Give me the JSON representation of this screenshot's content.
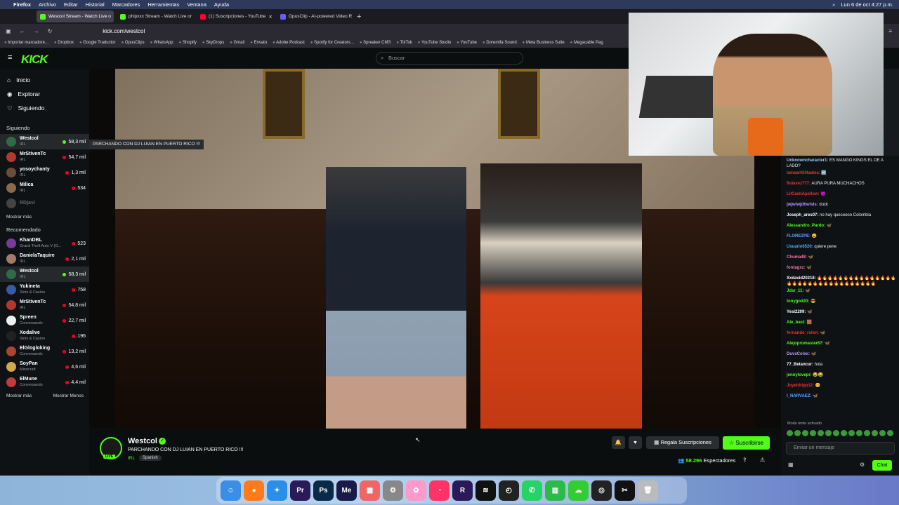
{
  "macmenu": {
    "apple": "",
    "items": [
      "Firefox",
      "Archivo",
      "Editar",
      "Historial",
      "Marcadores",
      "Herramientas",
      "Ventana",
      "Ayuda"
    ],
    "clock": "Lun 6 de oct  4:27 p.m."
  },
  "tabs": [
    {
      "label": "Westcol Stream - Watch Live o",
      "color": "#53fc18"
    },
    {
      "label": "phipxxx Stream - Watch Live or",
      "color": "#53fc18"
    },
    {
      "label": "(1) Suscripciones - YouTube",
      "color": "#ff0033"
    },
    {
      "label": "OpusClip - AI-powered Video R",
      "color": "#6b5bff"
    }
  ],
  "url": "kick.com/westcol",
  "bookmarks": [
    "Importar marcadore...",
    "Dropbox",
    "Google Traductor",
    "OpusClips",
    "WhatsApp",
    "Shopify",
    "SkyDrops",
    "Gmail",
    "Envato",
    "Adobe Podcast",
    "Spotify for Creators...",
    "Spreaker CMS",
    "TikTok",
    "YouTube Studio",
    "YouTube",
    "Doremifa Sound",
    "Meta Business Suite",
    "Megacable Pag"
  ],
  "kick": {
    "logo": "KICK",
    "search_placeholder": "Buscar"
  },
  "nav": [
    {
      "label": "Inicio",
      "icon": "⌂"
    },
    {
      "label": "Explorar",
      "icon": "◉"
    },
    {
      "label": "Siguiendo",
      "icon": "♡"
    }
  ],
  "following_title": "Siguiendo",
  "following": [
    {
      "name": "Westcol",
      "cat": "IRL",
      "viewers": "58,3 mil",
      "live": true,
      "color": "#2e6b4a"
    },
    {
      "name": "MrStivenTc",
      "cat": "IRL",
      "viewers": "54,7 mil",
      "live": false,
      "color": "#b03a2e"
    },
    {
      "name": "yosoychanty",
      "cat": "IRL",
      "viewers": "1,3 mil",
      "live": false,
      "color": "#6a4e3a"
    },
    {
      "name": "Milica",
      "cat": "IRL",
      "viewers": "534",
      "live": false,
      "color": "#8a6a4a"
    },
    {
      "name": "RDjavi",
      "cat": "",
      "viewers": "",
      "live": false,
      "color": "#444"
    }
  ],
  "show_more": "Mostrar más",
  "recommended_title": "Recomendado",
  "recommended": [
    {
      "name": "KhanDBL",
      "cat": "Grand Theft Auto V (G...",
      "viewers": "523",
      "live": false,
      "color": "#7a3a9a"
    },
    {
      "name": "DanielaTaquire",
      "cat": "IRL",
      "viewers": "2,1 mil",
      "live": false,
      "color": "#a67a6a"
    },
    {
      "name": "Westcol",
      "cat": "IRL",
      "viewers": "58,3 mil",
      "live": true,
      "color": "#2e6b4a"
    },
    {
      "name": "Yukineta",
      "cat": "Slots & Casino",
      "viewers": "758",
      "live": false,
      "color": "#3a5aa6"
    },
    {
      "name": "MrStivenTc",
      "cat": "IRL",
      "viewers": "54,8 mil",
      "live": false,
      "color": "#b03a2e"
    },
    {
      "name": "Spreen",
      "cat": "Conversando",
      "viewers": "22,7 mil",
      "live": false,
      "color": "#eee"
    },
    {
      "name": "Xodalive",
      "cat": "Slots & Casino",
      "viewers": "196",
      "live": false,
      "color": "#222"
    },
    {
      "name": "ElGlogloking",
      "cat": "Conversando",
      "viewers": "13,2 mil",
      "live": false,
      "color": "#aa4433"
    },
    {
      "name": "SoyPan",
      "cat": "Minecraft",
      "viewers": "4,6 mil",
      "live": false,
      "color": "#d2a84a"
    },
    {
      "name": "ElMune",
      "cat": "Conversando",
      "viewers": "4,4 mil",
      "live": false,
      "color": "#c23a3a"
    }
  ],
  "show_more2": "Mostrar más",
  "show_less": "Mostrar Menos",
  "tooltip": "PARCHANDO CON DJ LUIAN EN PUERTO RICO !!!",
  "chat": [
    {
      "user": "Unknowncharacter1:",
      "text": " ES MANGO KINGS EL DE A LADO?",
      "color": "#9cf"
    },
    {
      "user": "lamaal420laatea:",
      "text": " 🆒",
      "color": "#e33"
    },
    {
      "user": "fkdavez777:",
      "text": " AURA PURA MUCHACHOS",
      "color": "#e33"
    },
    {
      "user": "LilCashApellow:",
      "text": " 😈",
      "color": "#e33"
    },
    {
      "user": "jwjwiwjdhwisls:",
      "text": " duck",
      "color": "#b9f"
    },
    {
      "user": "Joseph_ares07:",
      "text": " no hay quesoooo Colombia",
      "color": "#fff"
    },
    {
      "user": "Alessandro_Pardo:",
      "text": " 🦋",
      "color": "#53fc18"
    },
    {
      "user": "FLOREZPE:",
      "text": " 😀",
      "color": "#5af"
    },
    {
      "user": "Usuario6520:",
      "text": " quiere pene",
      "color": "#5af"
    },
    {
      "user": "Chuma48:",
      "text": " 🦋",
      "color": "#e7a"
    },
    {
      "user": "fontagxz:",
      "text": " 🦋",
      "color": "#e7a"
    },
    {
      "user": "Xxdavid20218:",
      "text": " 🔥🔥🔥🔥🔥🔥🔥🔥🔥🔥🔥🔥🔥🔥🔥🔥🔥🔥🔥🔥🔥🔥🔥🔥🔥🔥🔥🔥🔥🔥🔥🔥",
      "color": "#fff"
    },
    {
      "user": "Jdsr_11:",
      "text": " 🦋",
      "color": "#53fc18"
    },
    {
      "user": "tonygod20:",
      "text": " 😎",
      "color": "#53fc18"
    },
    {
      "user": "Yesi2209:",
      "text": " 🦋",
      "color": "#fff"
    },
    {
      "user": "Ale_bast:",
      "text": " 🟫",
      "color": "#53fc18"
    },
    {
      "user": "fernando_rolon:",
      "text": " 🦋",
      "color": "#e33"
    },
    {
      "user": "Alejopromaster67:",
      "text": " 🦋",
      "color": "#53fc18"
    },
    {
      "user": "DuvsColxx:",
      "text": " 🦋",
      "color": "#b9f"
    },
    {
      "user": "77_Betancur:",
      "text": " hola",
      "color": "#fff"
    },
    {
      "user": "jennylovepr:",
      "text": " 😂😂",
      "color": "#53fc18"
    },
    {
      "user": "Joyeldripp12:",
      "text": " 😊",
      "color": "#e33"
    },
    {
      "user": "I_NARVAEZ:",
      "text": " 🦋",
      "color": "#5af"
    }
  ],
  "chat_mode": "Modo lento activado",
  "chat_placeholder": "Enviar un mensaje",
  "chat_button": "Chat",
  "stream": {
    "channel": "Westcol",
    "live_badge": "LIVE",
    "title": "PARCHANDO CON DJ  LUIAN EN PUERTO RICO !!!",
    "category": "IRL",
    "language": "Spanish",
    "gift_label": "Regala Suscripciones",
    "subscribe_label": "Suscribirse",
    "viewers": "58.296",
    "viewers_label": "Espectadores"
  },
  "dock": [
    {
      "name": "Finder",
      "color": "#3a8ee6",
      "glyph": "☺"
    },
    {
      "name": "Firefox",
      "color": "#ff7a1a",
      "glyph": "●"
    },
    {
      "name": "Safari",
      "color": "#2a8fe6",
      "glyph": "✦"
    },
    {
      "name": "Premiere",
      "color": "#2a1a5a",
      "glyph": "Pr"
    },
    {
      "name": "Photoshop",
      "color": "#0a2a4a",
      "glyph": "Ps"
    },
    {
      "name": "Media Encoder",
      "color": "#1a1a4a",
      "glyph": "Me"
    },
    {
      "name": "Launchpad",
      "color": "#e66",
      "glyph": "▦"
    },
    {
      "name": "Settings",
      "color": "#888",
      "glyph": "⚙"
    },
    {
      "name": "Photos",
      "color": "#f9c",
      "glyph": "✿"
    },
    {
      "name": "Messenger",
      "color": "#f36",
      "glyph": "◔"
    },
    {
      "name": "Premiere Rush",
      "color": "#2a1a5a",
      "glyph": "R"
    },
    {
      "name": "Spotify",
      "color": "#111",
      "glyph": "≋"
    },
    {
      "name": "Speed",
      "color": "#222",
      "glyph": "◴"
    },
    {
      "name": "WhatsApp",
      "color": "#25d366",
      "glyph": "✆"
    },
    {
      "name": "Numbers",
      "color": "#2bbb4a",
      "glyph": "▥"
    },
    {
      "name": "Cloud",
      "color": "#3c3",
      "glyph": "☁"
    },
    {
      "name": "OBS",
      "color": "#222",
      "glyph": "◎"
    },
    {
      "name": "CapCut",
      "color": "#111",
      "glyph": "✂"
    },
    {
      "name": "Trash",
      "color": "#bbb",
      "glyph": "🗑"
    }
  ]
}
